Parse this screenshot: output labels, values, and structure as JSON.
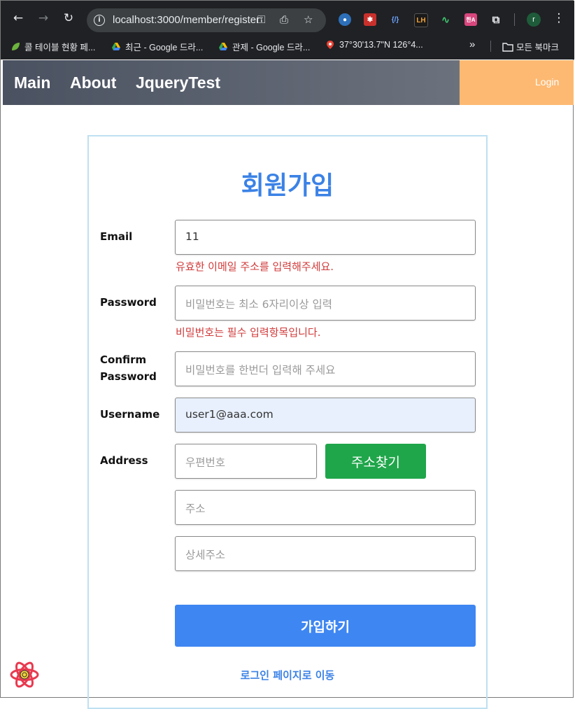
{
  "browser": {
    "url": "localhost:3000/member/register",
    "extensions": [
      {
        "icon": "globe-extension-icon",
        "text": ""
      },
      {
        "icon": "bug-extension-icon",
        "text": ""
      },
      {
        "icon": "code-extension-icon",
        "text": "{/}"
      },
      {
        "icon": "lighthouse-extension-icon",
        "text": "LH"
      },
      {
        "icon": "wave-extension-icon",
        "text": ""
      },
      {
        "icon": "translate-extension-icon",
        "text": "한A"
      }
    ],
    "profile_initial": "r",
    "bookmarks": [
      {
        "label": "콜 테이블 현황 페...",
        "icon": "leaf-icon"
      },
      {
        "label": "최근 - Google 드라...",
        "icon": "google-drive-icon"
      },
      {
        "label": "관제 - Google 드라...",
        "icon": "google-drive-icon"
      },
      {
        "label": "37°30'13.7\"N 126°4...",
        "icon": "map-pin-icon"
      }
    ],
    "more_bookmarks": "»",
    "all_bookmarks": "모든 북마크"
  },
  "nav": {
    "links": [
      "Main",
      "About",
      "JqueryTest"
    ],
    "login": "Login"
  },
  "form": {
    "title": "회원가입",
    "email": {
      "label": "Email",
      "value": "11",
      "error": "유효한 이메일 주소를 입력해주세요."
    },
    "password": {
      "label": "Password",
      "placeholder": "비밀번호는 최소 6자리이상 입력",
      "error": "비밀번호는 필수 입력항목입니다."
    },
    "confirm": {
      "label_line1": "Confirm",
      "label_line2": "Password",
      "placeholder": "비밀번호를 한번더 입력해 주세요"
    },
    "username": {
      "label": "Username",
      "value": "user1@aaa.com"
    },
    "address": {
      "label": "Address",
      "zip_placeholder": "우편번호",
      "find_button": "주소찾기",
      "addr_placeholder": "주소",
      "detail_placeholder": "상세주소"
    },
    "submit": "가입하기",
    "go_login": "로그인 페이지로 이동"
  },
  "colors": {
    "accent": "#3b82e6",
    "error": "#d13a3a",
    "find_button": "#1fa64a",
    "submit_button": "#3e86f2",
    "login_box": "#fdb972"
  }
}
